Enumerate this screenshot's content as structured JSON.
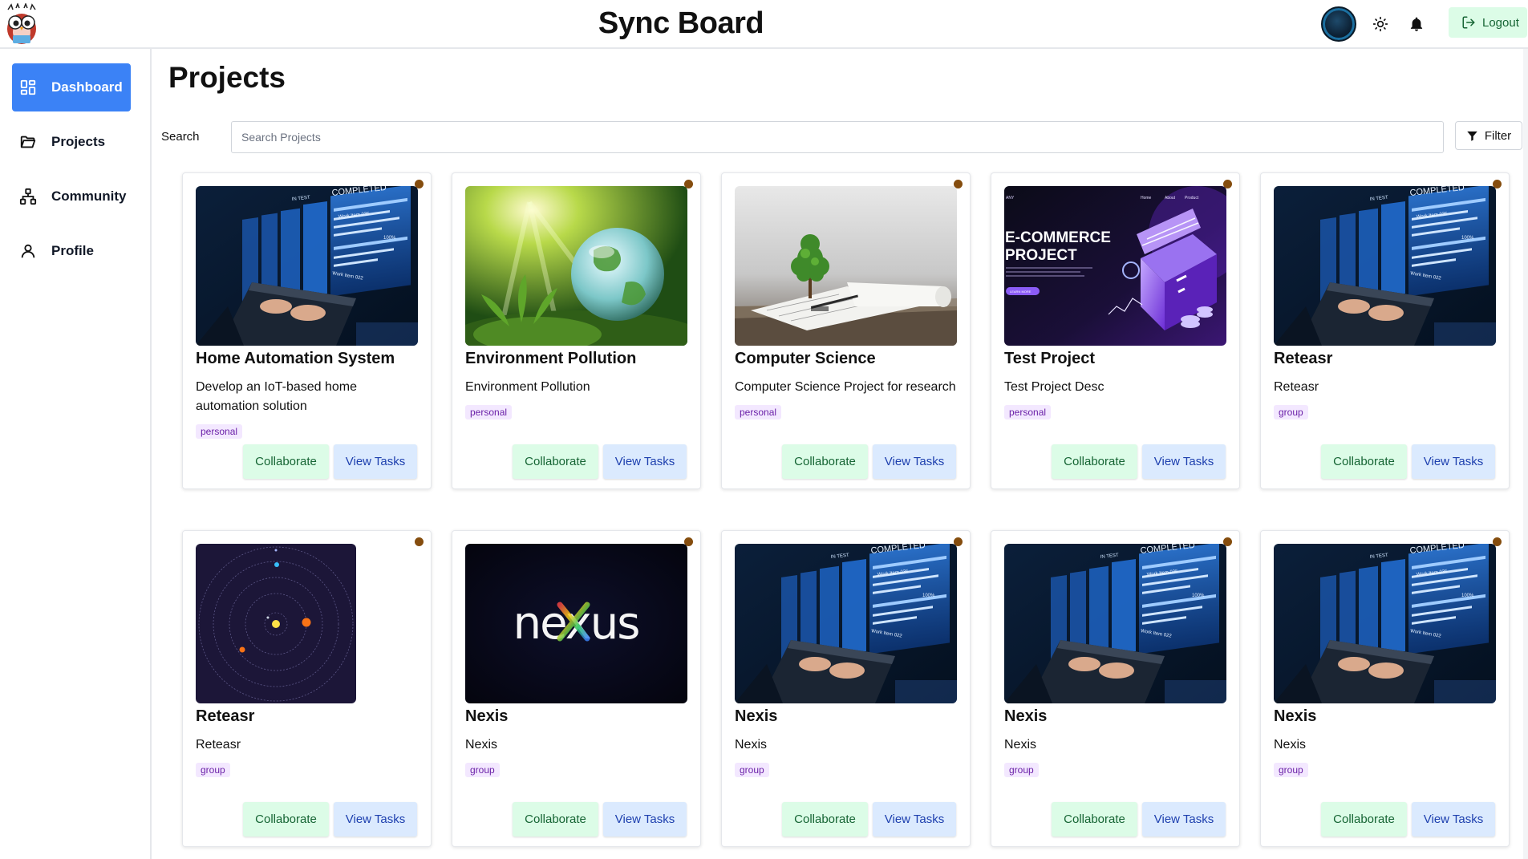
{
  "header": {
    "title": "Sync Board",
    "logout_label": "Logout"
  },
  "sidebar": {
    "items": [
      {
        "label": "Dashboard",
        "active": true
      },
      {
        "label": "Projects",
        "active": false
      },
      {
        "label": "Community",
        "active": false
      },
      {
        "label": "Profile",
        "active": false
      }
    ]
  },
  "main": {
    "page_title": "Projects",
    "search_label": "Search",
    "search_placeholder": "Search Projects",
    "search_value": "",
    "filter_label": "Filter"
  },
  "projects": [
    {
      "title": "Home Automation System",
      "desc": "Develop an IoT-based home automation solution",
      "tag": "personal",
      "image": "tech-dashboard",
      "collab": "Collaborate",
      "tasks": "View Tasks"
    },
    {
      "title": "Environment Pollution",
      "desc": "Environment Pollution",
      "tag": "personal",
      "image": "green-globe",
      "collab": "Collaborate",
      "tasks": "View Tasks"
    },
    {
      "title": "Computer Science",
      "desc": "Computer Science Project for research",
      "tag": "personal",
      "image": "tree-blueprints",
      "collab": "Collaborate",
      "tasks": "View Tasks"
    },
    {
      "title": "Test Project",
      "desc": "Test Project Desc",
      "tag": "personal",
      "image": "ecommerce-banner",
      "collab": "Collaborate",
      "tasks": "View Tasks"
    },
    {
      "title": "Reteasr",
      "desc": "Reteasr",
      "tag": "group",
      "image": "tech-dashboard",
      "collab": "Collaborate",
      "tasks": "View Tasks"
    },
    {
      "title": "Reteasr",
      "desc": "Reteasr",
      "tag": "group",
      "image": "solar-system",
      "collab": "Collaborate",
      "tasks": "View Tasks"
    },
    {
      "title": "Nexis",
      "desc": "Nexis",
      "tag": "group",
      "image": "nexus-logo",
      "collab": "Collaborate",
      "tasks": "View Tasks"
    },
    {
      "title": "Nexis",
      "desc": "Nexis",
      "tag": "group",
      "image": "tech-dashboard",
      "collab": "Collaborate",
      "tasks": "View Tasks"
    },
    {
      "title": "Nexis",
      "desc": "Nexis",
      "tag": "group",
      "image": "tech-dashboard",
      "collab": "Collaborate",
      "tasks": "View Tasks"
    },
    {
      "title": "Nexis",
      "desc": "Nexis",
      "tag": "group",
      "image": "tech-dashboard",
      "collab": "Collaborate",
      "tasks": "View Tasks"
    }
  ],
  "images": {
    "tech_completed": "COMPLETED",
    "tech_in_test": "IN TEST",
    "tech_work_item_1": "Work Item 035",
    "tech_work_item_2": "Work Item 022",
    "tech_pct": "100%",
    "ecom_headline_1": "E-COMMERCE",
    "ecom_headline_2": "PROJECT",
    "ecom_nav": [
      "Home",
      "About",
      "Product"
    ],
    "ecom_corner": "ANY",
    "ecom_cta": "LEARN MORE",
    "nexus_text": "nexus"
  },
  "colors": {
    "primary": "#3b82f6",
    "collab_bg": "#dcfce7",
    "collab_text": "#166534",
    "tasks_bg": "#dbeafe",
    "tasks_text": "#1e40af",
    "tag_bg": "#f3e8ff",
    "tag_text": "#6b21a8",
    "status_dot": "#854d0e"
  }
}
